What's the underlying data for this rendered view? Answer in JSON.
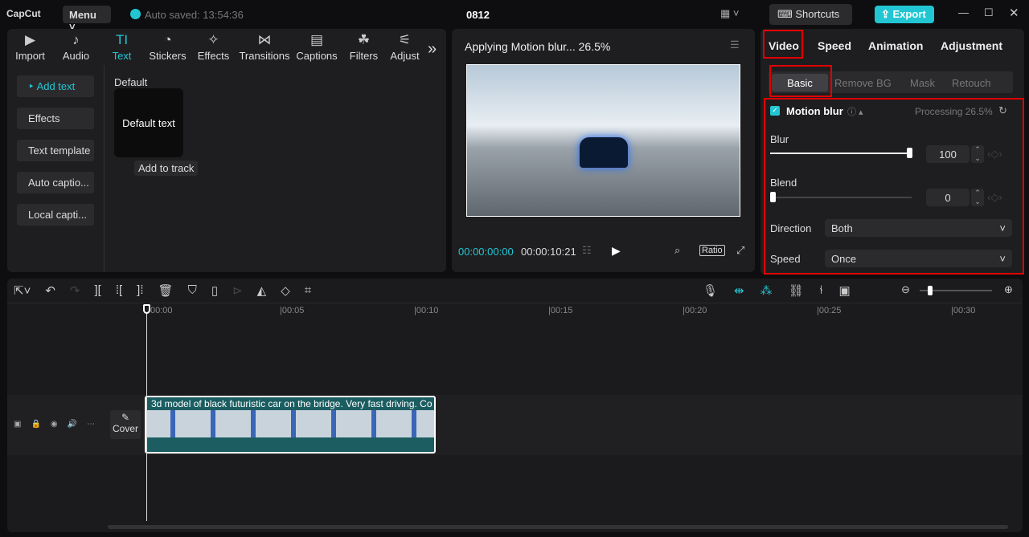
{
  "app": {
    "logo": "CapCut",
    "menu": "Menu",
    "autosave": "Auto saved: 13:54:36",
    "project": "0812",
    "shortcuts": "Shortcuts",
    "export": "Export"
  },
  "tools": [
    {
      "label": "Import",
      "icon": "▶"
    },
    {
      "label": "Audio",
      "icon": "♪"
    },
    {
      "label": "Text",
      "icon": "TI"
    },
    {
      "label": "Stickers",
      "icon": "◔"
    },
    {
      "label": "Effects",
      "icon": "✧"
    },
    {
      "label": "Transitions",
      "icon": "⋈"
    },
    {
      "label": "Captions",
      "icon": "▤"
    },
    {
      "label": "Filters",
      "icon": "☘"
    },
    {
      "label": "Adjust",
      "icon": "⚟"
    }
  ],
  "text_sidebar": [
    "Add text",
    "Effects",
    "Text template",
    "Auto captio...",
    "Local capti..."
  ],
  "text_panel": {
    "section": "Default",
    "card": "Default text",
    "tooltip": "Add to track"
  },
  "player": {
    "title": "Applying Motion blur... 26.5%",
    "current": "00:00:00:00",
    "total": "00:00:10:21",
    "ratio": "Ratio"
  },
  "inspector": {
    "tabs": [
      "Video",
      "Speed",
      "Animation",
      "Adjustment"
    ],
    "subtabs": [
      "Basic",
      "Remove BG",
      "Mask",
      "Retouch"
    ],
    "effect": "Motion blur",
    "processing": "Processing 26.5%",
    "blur_label": "Blur",
    "blur_value": "100",
    "blur_fraction": 1.0,
    "blend_label": "Blend",
    "blend_value": "0",
    "blend_fraction": 0.0,
    "direction_label": "Direction",
    "direction_value": "Both",
    "speed_label": "Speed",
    "speed_value": "Once"
  },
  "timeline": {
    "ticks": [
      "00:00",
      "|00:05",
      "|00:10",
      "|00:15",
      "|00:20",
      "|00:25",
      "|00:30"
    ],
    "clip_title": "3d model of black futuristic car on the bridge. Very fast driving. Co",
    "cover": "Cover"
  },
  "colors": {
    "accent": "#22c6d3",
    "highlight": "#e00000"
  }
}
